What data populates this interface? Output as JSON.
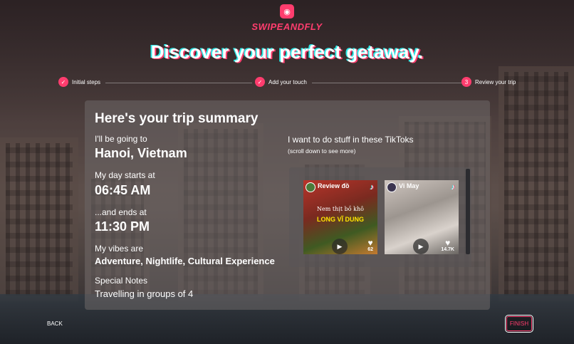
{
  "brand": {
    "name": "SWIPEANDFLY",
    "logo_icon": "pin-icon",
    "accent": "#ff3d6e"
  },
  "headline": "Discover your perfect getaway.",
  "steps": [
    {
      "label": "Initial steps",
      "status": "complete",
      "marker": "✓"
    },
    {
      "label": "Add your touch",
      "status": "complete",
      "marker": "✓"
    },
    {
      "label": "Review your trip",
      "status": "current",
      "marker": "3"
    }
  ],
  "summary": {
    "title": "Here's your trip summary",
    "destination_label": "I'll be going to",
    "destination": "Hanoi, Vietnam",
    "start_label": "My day starts at",
    "start_time": "06:45 AM",
    "end_label": "...and ends at",
    "end_time": "11:30 PM",
    "vibes_label": "My vibes are",
    "vibes": "Adventure, Nightlife, Cultural Experience",
    "notes_label": "Special Notes",
    "notes": "Travelling in groups of 4"
  },
  "tiktoks": {
    "title": "I want to do stuff in these TikToks",
    "hint": "(scroll down to see more)",
    "videos": [
      {
        "creator": "Review đồ",
        "caption": "Nem thịt bồ khô",
        "highlight": "LONG VĨ DUNG",
        "likes": "62"
      },
      {
        "creator": "Vi May",
        "caption": "",
        "highlight": "",
        "likes": "14.7K"
      }
    ]
  },
  "nav": {
    "back_label": "BACK",
    "finish_label": "FINISH"
  }
}
